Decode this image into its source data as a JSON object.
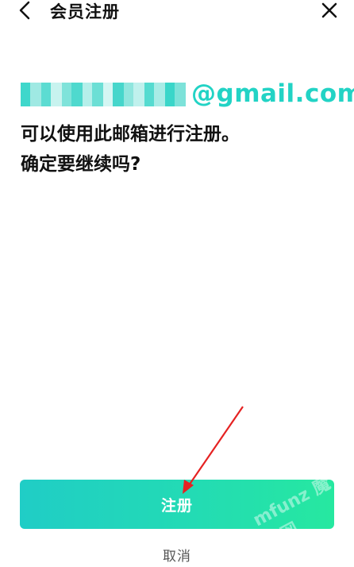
{
  "header": {
    "title": "会员注册",
    "back_icon": "chevron-left-icon",
    "close_icon": "close-icon"
  },
  "email": {
    "visible_domain": "@gmail.com",
    "masked": true,
    "color": "#22d3c5"
  },
  "message": {
    "line1": "可以使用此邮箱进行注册。",
    "line2": "确定要继续吗?"
  },
  "register_button": {
    "label": "注册",
    "gradient_start": "#20cdc6",
    "gradient_end": "#26e8a0"
  },
  "cancel_link": {
    "label": "取消"
  },
  "watermark": {
    "text": "mfunz 魔趣网"
  },
  "annotation": {
    "arrow_color": "#e52222"
  }
}
